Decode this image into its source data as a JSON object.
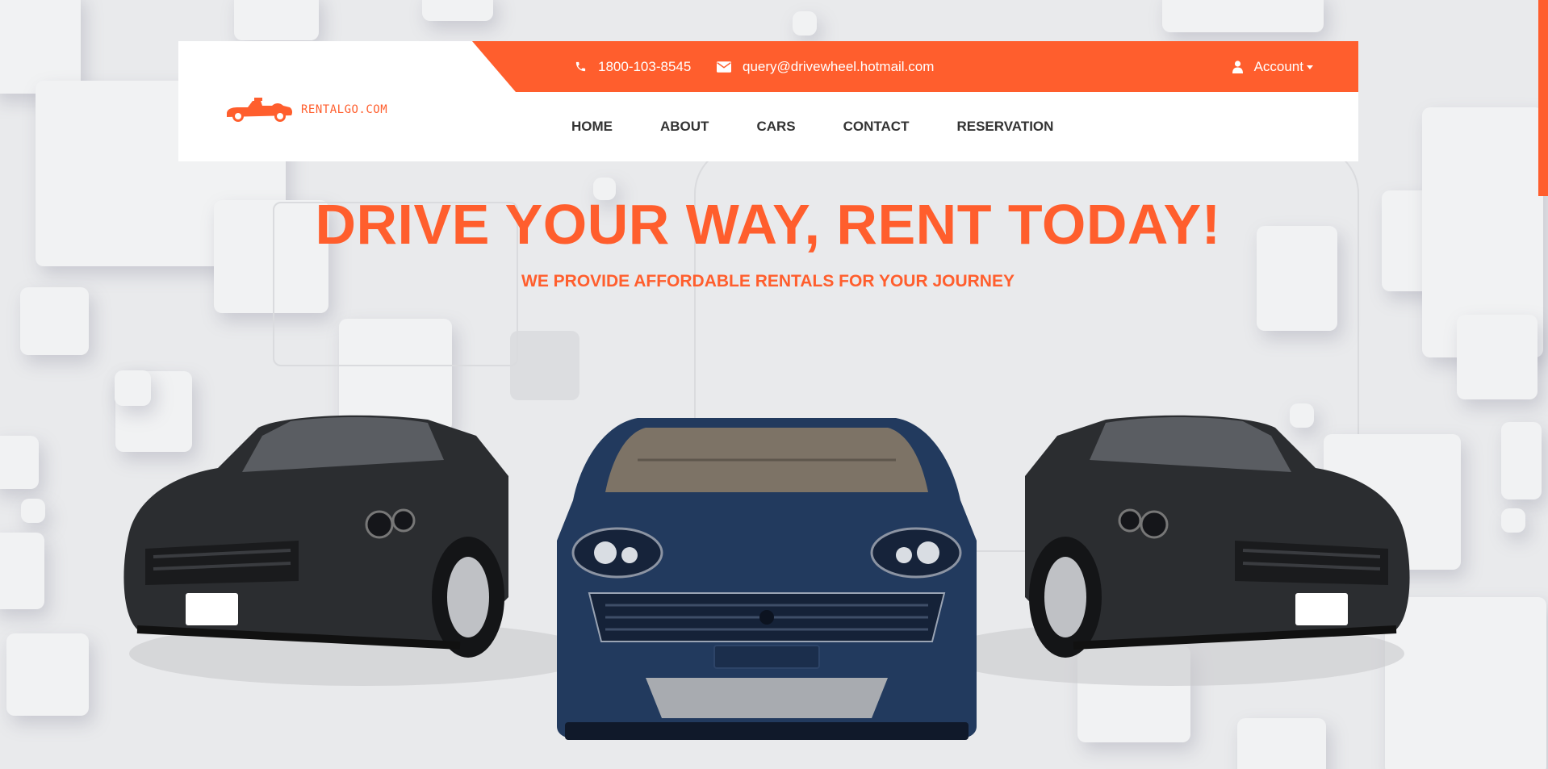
{
  "header": {
    "phone": "1800-103-8545",
    "email": "query@drivewheel.hotmail.com",
    "account_label": "Account",
    "logo_text": "RENTALGO.COM"
  },
  "nav": {
    "items": [
      {
        "label": "HOME"
      },
      {
        "label": "ABOUT"
      },
      {
        "label": "CARS"
      },
      {
        "label": "CONTACT"
      },
      {
        "label": "RESERVATION"
      }
    ]
  },
  "hero": {
    "title": "DRIVE YOUR WAY, RENT TODAY!",
    "subtitle": "WE PROVIDE AFFORDABLE RENTALS FOR YOUR JOURNEY"
  },
  "colors": {
    "accent": "#ff5e2d",
    "background": "#e9eaec",
    "nav_text": "#333333",
    "car_dark": "#2b2d30",
    "car_blue": "#223a5e"
  },
  "icons": {
    "phone": "phone-icon",
    "email": "envelope-icon",
    "account": "user-icon",
    "logo": "race-car-icon"
  }
}
